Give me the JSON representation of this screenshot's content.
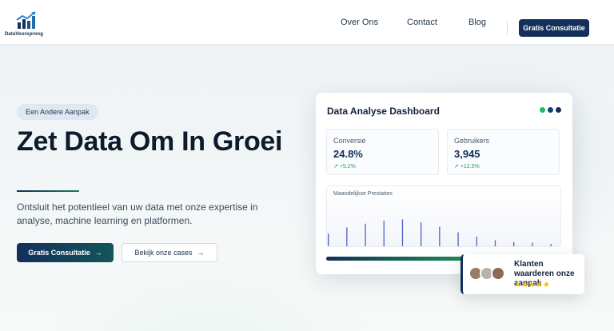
{
  "header": {
    "logo_text": "DataVoorsprong",
    "nav": [
      "Over Ons",
      "Contact",
      "Blog"
    ],
    "cta_label": "Gratis Consultatie"
  },
  "hero": {
    "badge": "Een Andere Aanpak",
    "title": "Zet Data Om In Groei",
    "subtitle": "Ontsluit het potentieel van uw data met onze expertise in analyse, machine learning en platformen.",
    "primary_button": "Gratis Consultatie",
    "secondary_button": "Bekijk onze cases"
  },
  "dashboard": {
    "title": "Data Analyse Dashboard",
    "dots": [
      "#21b86a",
      "#14457a",
      "#12305a"
    ],
    "stats": [
      {
        "label": "Conversie",
        "value": "24.8%",
        "delta": "+5.2%"
      },
      {
        "label": "Gebruikers",
        "value": "3,945",
        "delta": "+12.5%"
      }
    ],
    "chart_title": "Maandelijkse Prestaties",
    "chart_bar_levels": [
      0.22,
      0.32,
      0.38,
      0.43,
      0.45,
      0.4,
      0.33,
      0.24,
      0.17,
      0.11,
      0.08,
      0.07,
      0.05
    ],
    "progress": 0.58
  },
  "review": {
    "text": "Klanten waarderen onze aanpak",
    "stars": "★★★★★",
    "rating": 5
  }
}
